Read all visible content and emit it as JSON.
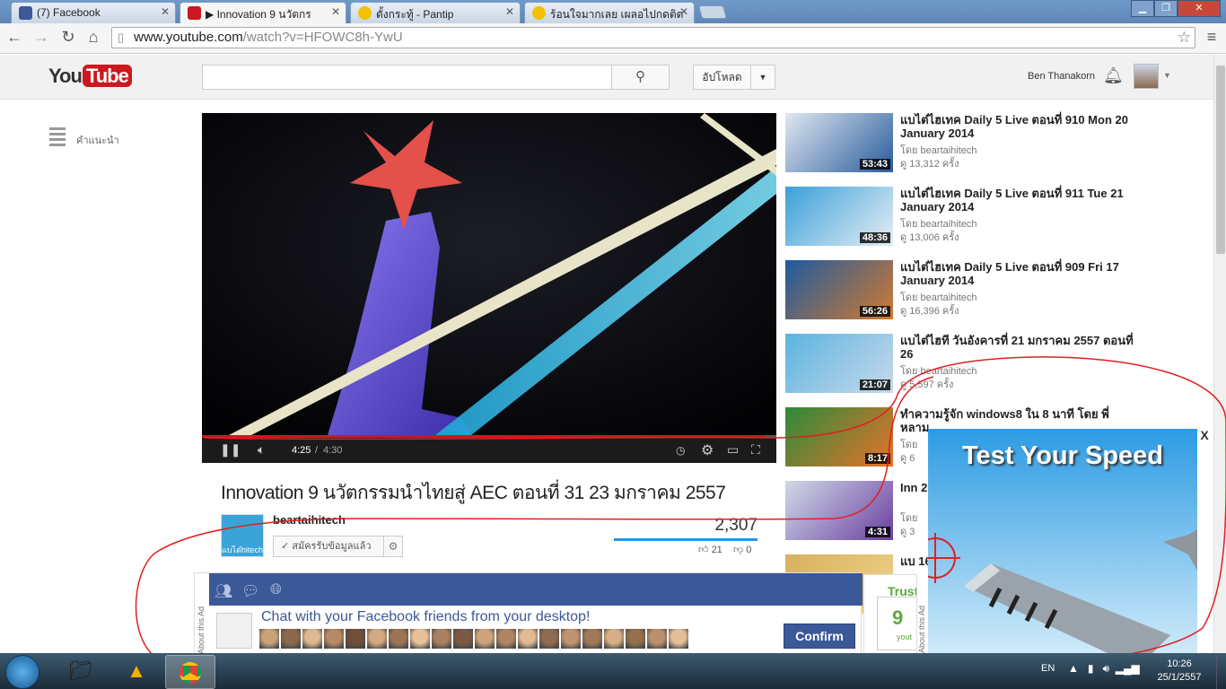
{
  "browser": {
    "tabs": [
      {
        "title": "(7) Facebook",
        "icon": "facebook-icon",
        "active": false
      },
      {
        "title": "▶ Innovation 9 นวัตกร",
        "icon": "youtube-icon",
        "active": true
      },
      {
        "title": "ตั้งกระทู้ - Pantip",
        "icon": "pantip-icon",
        "active": false
      },
      {
        "title": "ร้อนใจมากเลย เผลอไปกดติด",
        "icon": "pantip-icon",
        "active": false
      }
    ],
    "url_host": "www.youtube.com",
    "url_path": "/watch?v=HFOWC8h-YwU"
  },
  "youtube": {
    "logo_you": "You",
    "logo_tube": "Tube",
    "upload_label": "อัปโหลด",
    "user_name": "Ben Thanakorn",
    "guide_label": "คำแนะนำ"
  },
  "player": {
    "time_current": "4:25",
    "time_total": "4:30",
    "progress": 0.98
  },
  "video": {
    "title": "Innovation 9 นวัตกรรมนำไทยสู่ AEC ตอนที่ 31 23 มกราคม 2557",
    "channel": "beartaihitech",
    "channel_avatar_text": "แบไต๋hitech",
    "subscribed_label": "สมัครรับข้อมูลแล้ว",
    "views": "2,307",
    "likes": "21",
    "dislikes": "0"
  },
  "related": [
    {
      "title": "แบไต๋ไฮเทค Daily 5 Live ตอนที่ 910 Mon 20 January 2014",
      "by": "โดย beartaihitech",
      "views": "ดู 13,312 ครั้ง",
      "duration": "53:43",
      "colors": [
        "#dfe7f1",
        "#2a5c9c"
      ]
    },
    {
      "title": "แบไต๋ไฮเทค Daily 5 Live ตอนที่ 911 Tue 21 January 2014",
      "by": "โดย beartaihitech",
      "views": "ดู 13,006 ครั้ง",
      "duration": "48:36",
      "colors": [
        "#3aa0d8",
        "#e6eef6"
      ]
    },
    {
      "title": "แบไต๋ไฮเทค Daily 5 Live ตอนที่ 909 Fri 17 January 2014",
      "by": "โดย beartaihitech",
      "views": "ดู 16,396 ครั้ง",
      "duration": "56:26",
      "colors": [
        "#1e5aa0",
        "#d27a2e"
      ]
    },
    {
      "title": "แบไต๋ไฮที วันอังคารที่ 21 มกราคม 2557 ตอนที่ 26",
      "by": "โดย beartaihitech",
      "views": "ดู 5,597 ครั้ง",
      "duration": "21:07",
      "colors": [
        "#5ab4e0",
        "#c9d9ea"
      ]
    },
    {
      "title": "ทำความรู้จัก windows8 ใน 8 นาที โดย พี่หลาม",
      "by": "โดย",
      "views": "ดู 6",
      "duration": "8:17",
      "colors": [
        "#2c8a3a",
        "#e8722a"
      ]
    },
    {
      "title": "Inn 28",
      "by": "โดย",
      "views": "ดู 3",
      "duration": "4:31",
      "colors": [
        "#d0dae8",
        "#6b3fa0"
      ]
    },
    {
      "title": "แบ 16",
      "by": "",
      "views": "",
      "duration": "",
      "colors": [
        "#d8b060",
        "#f0d48a"
      ]
    }
  ],
  "fb_ad": {
    "about_label": "About this Ad",
    "text": "Chat with your Facebook friends from your desktop!",
    "confirm_label": "Confirm"
  },
  "trust_ad": {
    "title": "Trust",
    "number": "9",
    "sub": "yout",
    "about_label": "About this Ad"
  },
  "speed_ad": {
    "title": "Test Your Speed",
    "close": "X"
  },
  "taskbar": {
    "lang": "EN",
    "time": "10:26",
    "date": "25/1/2557"
  },
  "colors": {
    "youtube_red": "#cc181e",
    "facebook_blue": "#3b5998",
    "annotation_red": "#e02020"
  }
}
